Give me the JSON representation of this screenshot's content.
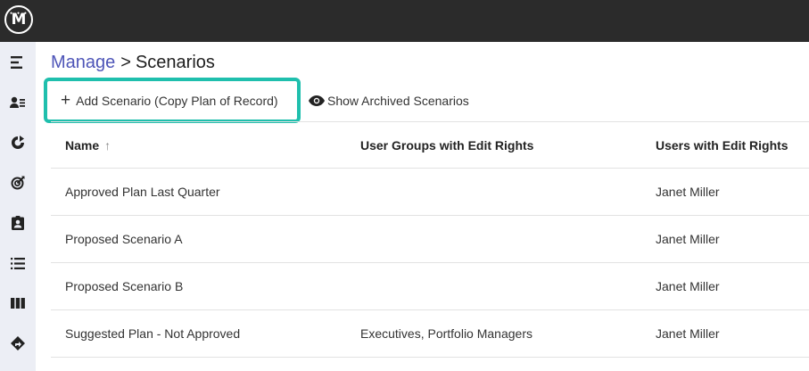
{
  "app": {
    "logo_text": "M",
    "logo_dots": "• • •"
  },
  "sidebar": {
    "items": [
      {
        "name": "sidebar-item-menu",
        "icon": "menu-lines-icon"
      },
      {
        "name": "sidebar-item-people",
        "icon": "person-list-icon"
      },
      {
        "name": "sidebar-item-cycle",
        "icon": "refresh-circle-icon"
      },
      {
        "name": "sidebar-item-goals",
        "icon": "target-icon"
      },
      {
        "name": "sidebar-item-contacts",
        "icon": "contact-badge-icon"
      },
      {
        "name": "sidebar-item-list",
        "icon": "bullet-list-icon"
      },
      {
        "name": "sidebar-item-columns",
        "icon": "columns-icon"
      },
      {
        "name": "sidebar-item-directions",
        "icon": "directions-icon"
      }
    ]
  },
  "breadcrumb": {
    "parent": "Manage",
    "separator": ">",
    "current": "Scenarios"
  },
  "toolbar": {
    "add_label": "Add Scenario (Copy Plan of Record)",
    "add_icon": "+",
    "archived_label": "Show Archived Scenarios"
  },
  "table": {
    "columns": [
      "Name",
      "User Groups with Edit Rights",
      "Users with Edit Rights"
    ],
    "sort_icon": "↑",
    "rows": [
      {
        "name": "Approved Plan Last Quarter",
        "groups": "",
        "users": "Janet Miller"
      },
      {
        "name": "Proposed Scenario A",
        "groups": "",
        "users": "Janet Miller"
      },
      {
        "name": "Proposed Scenario B",
        "groups": "",
        "users": "Janet Miller"
      },
      {
        "name": "Suggested Plan - Not Approved",
        "groups": "Executives, Portfolio Managers",
        "users": "Janet Miller"
      }
    ]
  },
  "colors": {
    "topbar": "#2b2b2b",
    "sidebar": "#eceef5",
    "link": "#4e55b8",
    "highlight": "#1fbfad"
  }
}
